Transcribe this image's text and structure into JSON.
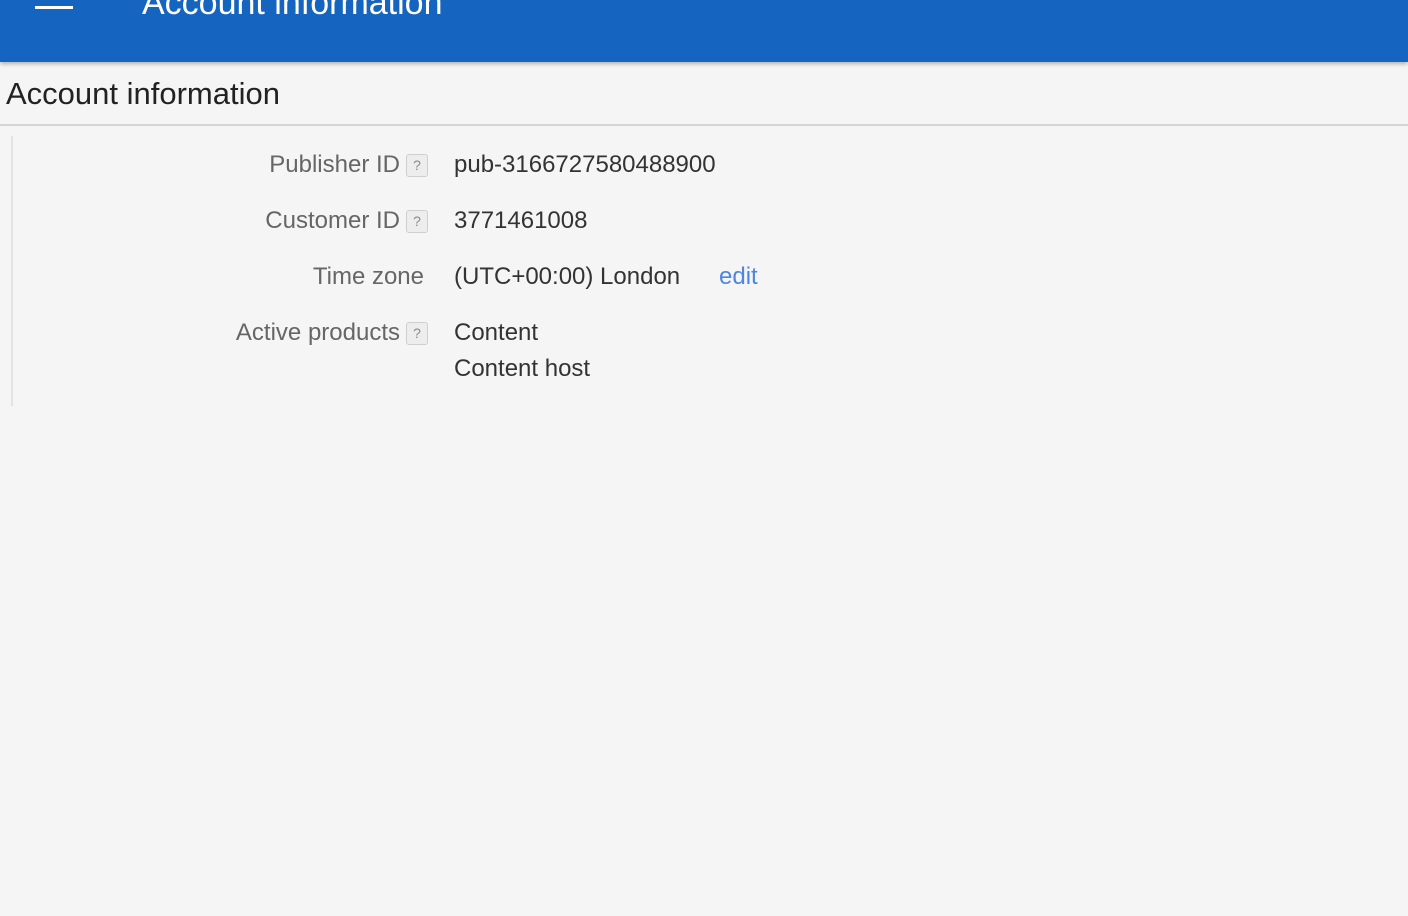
{
  "appbar": {
    "title": "Account information",
    "menu_icon": "hamburger-menu-icon",
    "color": "#1565c0"
  },
  "section": {
    "title": "Account information"
  },
  "fields": {
    "publisher_id": {
      "label": "Publisher ID",
      "help": "?",
      "value": "pub-3166727580488900"
    },
    "customer_id": {
      "label": "Customer ID",
      "help": "?",
      "value": "3771461008"
    },
    "time_zone": {
      "label": "Time zone",
      "value": "(UTC+00:00) London",
      "edit_label": "edit"
    },
    "active_products": {
      "label": "Active products",
      "help": "?",
      "items": [
        "Content",
        "Content host"
      ]
    }
  },
  "colors": {
    "link": "#4d86e0",
    "background": "#f5f5f5"
  }
}
